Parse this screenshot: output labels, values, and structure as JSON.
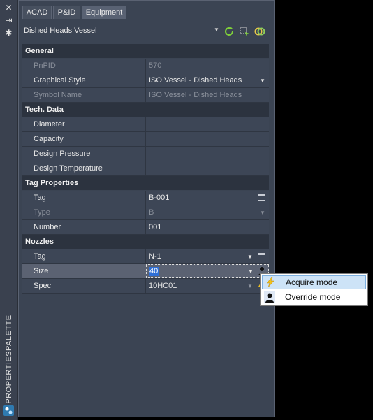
{
  "palette_title": "PROPERTIESPALETTE",
  "strip_buttons": [
    "close-icon",
    "autohide-icon",
    "settings-icon"
  ],
  "tabs": [
    {
      "label": "ACAD"
    },
    {
      "label": "P&ID"
    },
    {
      "label": "Equipment"
    }
  ],
  "selector": {
    "value": "Dished Heads Vessel"
  },
  "sections": {
    "general": "General",
    "tech": "Tech. Data",
    "tag": "Tag Properties",
    "nozzles": "Nozzles"
  },
  "general_rows": [
    {
      "label": "PnPID",
      "value": "570"
    },
    {
      "label": "Graphical Style",
      "value": "ISO Vessel - Dished Heads"
    },
    {
      "label": "Symbol Name",
      "value": "ISO Vessel - Dished Heads"
    }
  ],
  "tech_rows": [
    {
      "label": "Diameter",
      "value": ""
    },
    {
      "label": "Capacity",
      "value": ""
    },
    {
      "label": "Design Pressure",
      "value": ""
    },
    {
      "label": "Design Temperature",
      "value": ""
    }
  ],
  "tag_rows": [
    {
      "label": "Tag",
      "value": "B-001"
    },
    {
      "label": "Type",
      "value": "B"
    },
    {
      "label": "Number",
      "value": "001"
    }
  ],
  "nozzle_rows": [
    {
      "label": "Tag",
      "value": "N-1"
    },
    {
      "label": "Size",
      "value": "40"
    },
    {
      "label": "Spec",
      "value": "10HC01"
    }
  ],
  "popup": {
    "items": [
      {
        "label": "Acquire mode",
        "icon": "lightning-icon"
      },
      {
        "label": "Override mode",
        "icon": "person-icon"
      }
    ]
  },
  "colors": {
    "accent": "#2f6fd6",
    "panel": "#3b4453",
    "section": "#2c333f"
  }
}
